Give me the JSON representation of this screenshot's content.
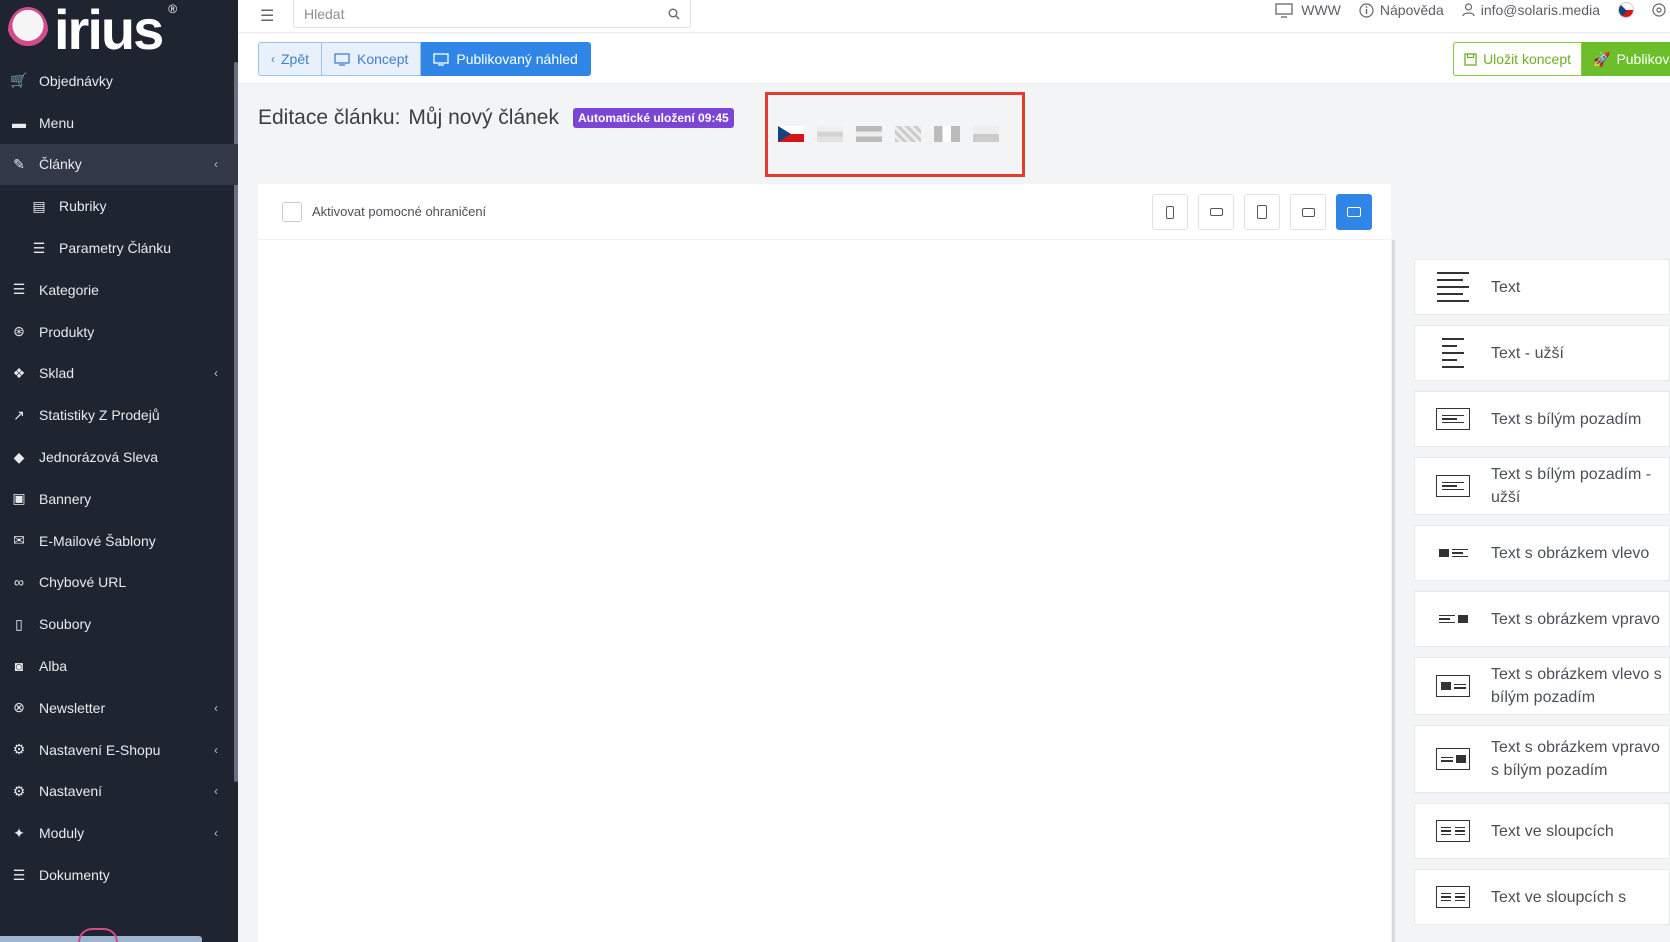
{
  "logo": {
    "text": "irius",
    "reg": "®"
  },
  "sidebar": {
    "items": [
      {
        "label": "Objednávky",
        "icon": "cart-icon",
        "glyph": "🛒",
        "chev": ""
      },
      {
        "label": "Menu",
        "icon": "folder-icon",
        "glyph": "▬",
        "chev": ""
      },
      {
        "label": "Články",
        "icon": "pencil-icon",
        "glyph": "✎",
        "chev": "‹"
      },
      {
        "label": "Rubriky",
        "icon": "newspaper-icon",
        "glyph": "▤",
        "chev": ""
      },
      {
        "label": "Parametry Článku",
        "icon": "sliders-icon",
        "glyph": "☰",
        "chev": ""
      },
      {
        "label": "Kategorie",
        "icon": "list-icon",
        "glyph": "☰",
        "chev": ""
      },
      {
        "label": "Produkty",
        "icon": "basketball-icon",
        "glyph": "⊛",
        "chev": ""
      },
      {
        "label": "Sklad",
        "icon": "dropbox-icon",
        "glyph": "❖",
        "chev": "‹"
      },
      {
        "label": "Statistiky Z Prodejů",
        "icon": "chart-icon",
        "glyph": "↗",
        "chev": ""
      },
      {
        "label": "Jednorázová Sleva",
        "icon": "tag-icon",
        "glyph": "◆",
        "chev": ""
      },
      {
        "label": "Bannery",
        "icon": "image-icon",
        "glyph": "▣",
        "chev": ""
      },
      {
        "label": "E-Mailové Šablony",
        "icon": "envelope-icon",
        "glyph": "✉",
        "chev": ""
      },
      {
        "label": "Chybové URL",
        "icon": "link-icon",
        "glyph": "∞",
        "chev": ""
      },
      {
        "label": "Soubory",
        "icon": "file-icon",
        "glyph": "▯",
        "chev": ""
      },
      {
        "label": "Alba",
        "icon": "camera-icon",
        "glyph": "◙",
        "chev": ""
      },
      {
        "label": "Newsletter",
        "icon": "newsletter-icon",
        "glyph": "⊗",
        "chev": "‹"
      },
      {
        "label": "Nastavení E-Shopu",
        "icon": "cogs-icon",
        "glyph": "⚙",
        "chev": "‹"
      },
      {
        "label": "Nastavení",
        "icon": "cogs-icon",
        "glyph": "⚙",
        "chev": "‹"
      },
      {
        "label": "Moduly",
        "icon": "puzzle-icon",
        "glyph": "✦",
        "chev": "‹"
      },
      {
        "label": "Dokumenty",
        "icon": "list-icon",
        "glyph": "☰",
        "chev": ""
      }
    ]
  },
  "topbar": {
    "search_placeholder": "Hledat",
    "www": "WWW",
    "help": "Nápověda",
    "user": "info@solaris.media"
  },
  "actions": {
    "back": "Zpět",
    "draft": "Koncept",
    "published_preview": "Publikovaný náhled",
    "save_draft": "Uložit koncept",
    "publish": "Publikovat"
  },
  "title": {
    "prefix": "Editace článku:",
    "name": "Můj nový článek",
    "autosave": "Automatické uložení 09:45"
  },
  "editor": {
    "helper_bounds_label": "Aktivovat pomocné ohraničení"
  },
  "blocks": [
    {
      "label": "Text"
    },
    {
      "label": "Text - užší"
    },
    {
      "label": "Text s bílým pozadím"
    },
    {
      "label": "Text s bílým pozadím - užší"
    },
    {
      "label": "Text s obrázkem vlevo"
    },
    {
      "label": "Text s obrázkem vpravo"
    },
    {
      "label": "Text s obrázkem vlevo s bílým pozadím"
    },
    {
      "label": "Text s obrázkem vpravo s bílým pozadím"
    },
    {
      "label": "Text ve sloupcích"
    },
    {
      "label": "Text ve sloupcích s"
    }
  ],
  "colors": {
    "sidebar": "#1f2431",
    "primary": "#2f86e6",
    "success": "#6cbf2a",
    "badge": "#7b45d6",
    "highlight": "#e53b2c"
  }
}
